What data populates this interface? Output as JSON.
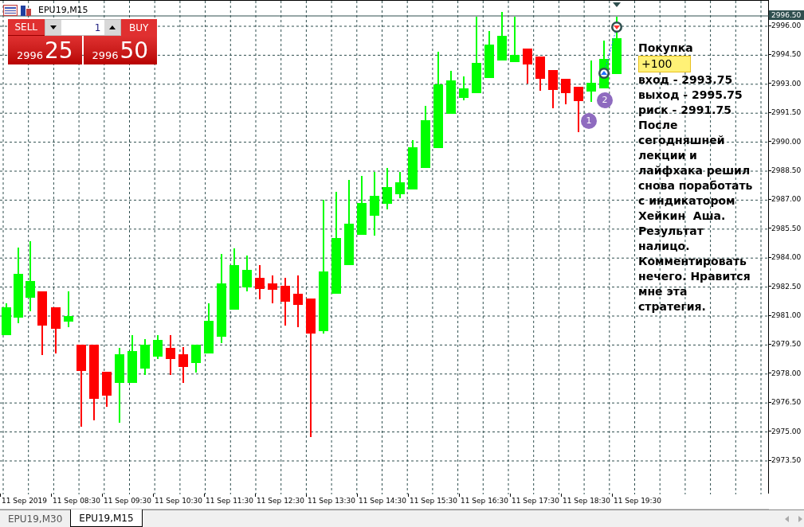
{
  "chart": {
    "symbol": "EPU19,M15",
    "current_price": "2996.50",
    "price_ticks": [
      "2996.00",
      "2994.50",
      "2993.00",
      "2991.50",
      "2990.00",
      "2988.50",
      "2987.00",
      "2985.50",
      "2984.00",
      "2982.50",
      "2981.00",
      "2979.50",
      "2978.00",
      "2976.50",
      "2975.00",
      "2973.50"
    ],
    "time_labels": [
      "11 Sep 2019",
      "11 Sep 08:30",
      "11 Sep 09:30",
      "11 Sep 10:30",
      "11 Sep 11:30",
      "11 Sep 12:30",
      "11 Sep 13:30",
      "11 Sep 14:30",
      "11 Sep 15:30",
      "11 Sep 16:30",
      "11 Sep 17:30",
      "11 Sep 18:30",
      "11 Sep 19:30"
    ]
  },
  "trade_panel": {
    "sell_label": "SELL",
    "buy_label": "BUY",
    "volume": "1",
    "sell_big": "2996",
    "sell_small": "25",
    "buy_big": "2996",
    "buy_small": "50"
  },
  "markers": [
    "1",
    "2"
  ],
  "annotation": {
    "title": "Покупка",
    "result": "+100",
    "lines": [
      "вход - 2993.75",
      "выход - 2995.75",
      "риск - 2991.75",
      "После",
      "сегодняшней",
      "лекции и",
      "лайфхака решил",
      "снова поработать",
      "с индикатором",
      "Хейкин  Аша.",
      "Результат",
      "налицо.",
      "Комментировать",
      "нечего. Нравится",
      "мне эта",
      "стратегия."
    ]
  },
  "tabs": [
    {
      "label": "EPU19,M30",
      "selected": false
    },
    {
      "label": "EPU19,M15",
      "selected": true
    }
  ]
}
